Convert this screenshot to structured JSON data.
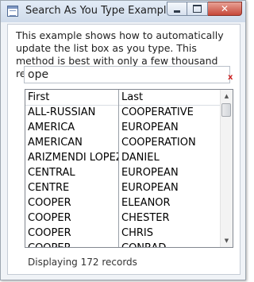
{
  "window": {
    "title": "Search As You Type Example"
  },
  "description": "This example shows how to automatically update the list box as you type.  This method is best with only a few thousand records.",
  "search": {
    "value": "ope",
    "clear_glyph": "x"
  },
  "list": {
    "headers": {
      "first": "First",
      "last": "Last"
    },
    "rows": [
      {
        "first": "ALL-RUSSIAN",
        "last": "COOPERATIVE"
      },
      {
        "first": "AMERICA",
        "last": "EUROPEAN"
      },
      {
        "first": "AMERICAN",
        "last": "COOPERATION"
      },
      {
        "first": "ARIZMENDI LOPEZ",
        "last": "DANIEL"
      },
      {
        "first": "CENTRAL",
        "last": "EUROPEAN"
      },
      {
        "first": "CENTRE",
        "last": "EUROPEAN"
      },
      {
        "first": "COOPER",
        "last": "ELEANOR"
      },
      {
        "first": "COOPER",
        "last": "CHESTER"
      },
      {
        "first": "COOPER",
        "last": "CHRIS"
      },
      {
        "first": "COOPER",
        "last": "CONRAD"
      }
    ]
  },
  "status": "Displaying 172 records",
  "icons": {
    "app": "form-icon",
    "minimize": "minimize-icon",
    "maximize": "maximize-icon",
    "close": "close-icon",
    "scroll_up": "chevron-up-icon",
    "scroll_down": "chevron-down-icon"
  },
  "colors": {
    "close_button": "#c7493a",
    "clear_x": "#cc2222"
  }
}
